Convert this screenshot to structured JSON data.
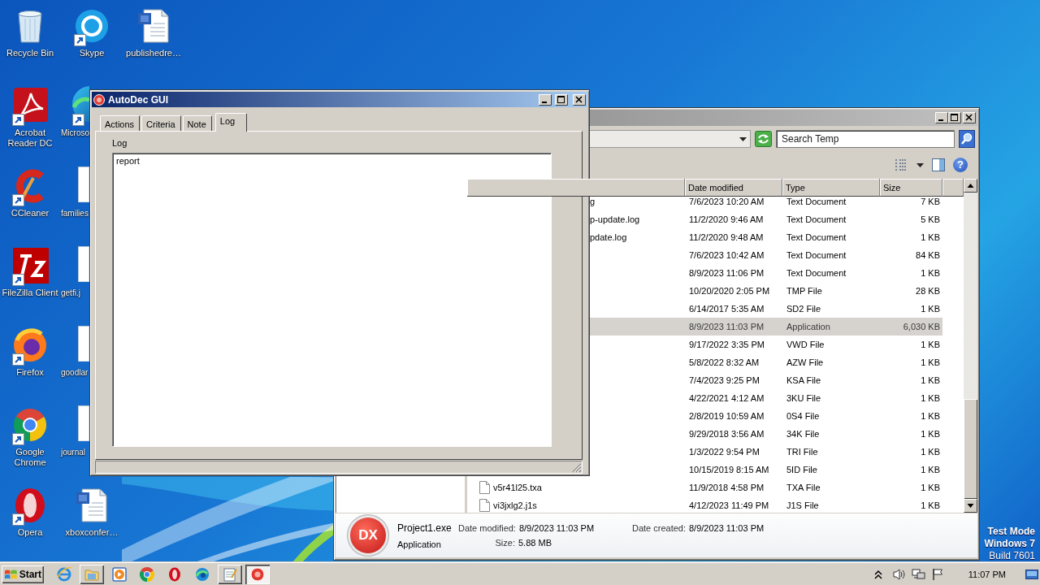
{
  "desktop": {
    "icon_columns": [
      [
        {
          "label": "Recycle Bin",
          "kind": "full",
          "shortcut": false
        },
        {
          "label": "Acrobat Reader DC",
          "kind": "full",
          "shortcut": true
        },
        {
          "label": "CCleaner",
          "kind": "full",
          "shortcut": true
        },
        {
          "label": "FileZilla Client",
          "kind": "full",
          "shortcut": true
        },
        {
          "label": "Firefox",
          "kind": "full",
          "shortcut": true
        },
        {
          "label": "Google Chrome",
          "kind": "full",
          "shortcut": true
        },
        {
          "label": "Opera",
          "kind": "full",
          "shortcut": true
        }
      ],
      [
        {
          "label": "Skype",
          "kind": "full",
          "shortcut": true
        },
        {
          "label": "Microso",
          "kind": "cut",
          "shortcut": true
        },
        {
          "label": "families",
          "kind": "cut",
          "shortcut": false
        },
        {
          "label": "getfi.j",
          "kind": "cut",
          "shortcut": false
        },
        {
          "label": "goodlar",
          "kind": "cut",
          "shortcut": false
        },
        {
          "label": "journal",
          "kind": "cut",
          "shortcut": false
        },
        {
          "label": "xboxconfer…",
          "kind": "full",
          "shortcut": false
        }
      ],
      [
        {
          "label": "publishedre…",
          "kind": "full",
          "shortcut": false
        }
      ]
    ],
    "system_note": [
      {
        "text": "Test Mode",
        "bold": true
      },
      {
        "text": "Windows 7",
        "bold": true
      },
      {
        "text": "Build 7601",
        "bold": false
      }
    ]
  },
  "explorer": {
    "search": {
      "placeholder": "Search Temp"
    },
    "help_glyph": "?",
    "columns": [
      "Date modified",
      "Type",
      "Size"
    ],
    "rows": [
      {
        "name": "g",
        "kind": "cut",
        "date": "7/6/2023 10:20 AM",
        "type": "Text Document",
        "size": "7 KB",
        "selected": false
      },
      {
        "name": "p-update.log",
        "kind": "cut",
        "date": "11/2/2020 9:46 AM",
        "type": "Text Document",
        "size": "5 KB",
        "selected": false
      },
      {
        "name": "pdate.log",
        "kind": "cut",
        "date": "11/2/2020 9:48 AM",
        "type": "Text Document",
        "size": "1 KB",
        "selected": false
      },
      {
        "kind": "covered",
        "date": "7/6/2023 10:42 AM",
        "type": "Text Document",
        "size": "84 KB",
        "selected": false
      },
      {
        "kind": "covered",
        "date": "8/9/2023 11:06 PM",
        "type": "Text Document",
        "size": "1 KB",
        "selected": false
      },
      {
        "kind": "covered",
        "date": "10/20/2020 2:05 PM",
        "type": "TMP File",
        "size": "28 KB",
        "selected": false
      },
      {
        "kind": "covered",
        "date": "6/14/2017 5:35 AM",
        "type": "SD2 File",
        "size": "1 KB",
        "selected": false
      },
      {
        "kind": "covered",
        "date": "8/9/2023 11:03 PM",
        "type": "Application",
        "size": "6,030 KB",
        "selected": true
      },
      {
        "kind": "covered",
        "date": "9/17/2022 3:35 PM",
        "type": "VWD File",
        "size": "1 KB",
        "selected": false
      },
      {
        "kind": "covered",
        "date": "5/8/2022 8:32 AM",
        "type": "AZW File",
        "size": "1 KB",
        "selected": false
      },
      {
        "kind": "covered",
        "date": "7/4/2023 9:25 PM",
        "type": "KSA File",
        "size": "1 KB",
        "selected": false
      },
      {
        "kind": "covered",
        "date": "4/22/2021 4:12 AM",
        "type": "3KU File",
        "size": "1 KB",
        "selected": false
      },
      {
        "kind": "covered",
        "date": "2/8/2019 10:59 AM",
        "type": "0S4 File",
        "size": "1 KB",
        "selected": false
      },
      {
        "kind": "covered",
        "date": "9/29/2018 3:56 AM",
        "type": "34K File",
        "size": "1 KB",
        "selected": false
      },
      {
        "kind": "covered",
        "date": "1/3/2022 9:54 PM",
        "type": "TRI File",
        "size": "1 KB",
        "selected": false
      },
      {
        "kind": "covered",
        "date": "10/15/2019 8:15 AM",
        "type": "5ID File",
        "size": "1 KB",
        "selected": false
      },
      {
        "name": "v5r41l25.txa",
        "kind": "file",
        "date": "11/9/2018 4:58 PM",
        "type": "TXA File",
        "size": "1 KB",
        "selected": false
      },
      {
        "name": "vi3jxlg2.j1s",
        "kind": "file",
        "date": "4/12/2023 11:49 PM",
        "type": "J1S File",
        "size": "1 KB",
        "selected": false
      }
    ],
    "details": {
      "icon_text": "DX",
      "name": "Project1.exe",
      "type": "Application",
      "fields": [
        {
          "label": "Date modified:",
          "value": "8/9/2023 11:03 PM"
        },
        {
          "label": "Size:",
          "value": "5.88 MB"
        },
        {
          "label": "Date created:",
          "value": "8/9/2023 11:03 PM"
        }
      ]
    }
  },
  "autodec": {
    "title": "AutoDec GUI",
    "tabs": [
      {
        "label": "Actions",
        "selected": false
      },
      {
        "label": "Criteria",
        "selected": false
      },
      {
        "label": "Note",
        "selected": false
      },
      {
        "label": "Log",
        "selected": true
      }
    ],
    "group_label": "Log",
    "log_text": "report"
  },
  "taskbar": {
    "start_label": "Start",
    "items": [
      {
        "kind": "launch"
      },
      {
        "kind": "task",
        "selected": false
      },
      {
        "kind": "launch"
      },
      {
        "kind": "launch"
      },
      {
        "kind": "launch"
      },
      {
        "kind": "launch"
      },
      {
        "kind": "task",
        "selected": false
      },
      {
        "kind": "task",
        "selected": true
      }
    ],
    "clock": "11:07 PM"
  }
}
